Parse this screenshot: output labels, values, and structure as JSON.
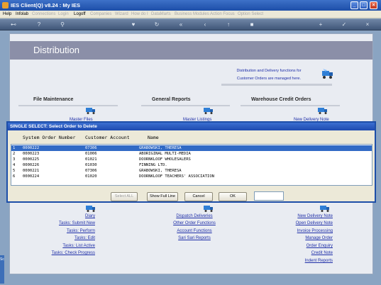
{
  "window": {
    "title": "IES Client(Q) v8.24 : My IES",
    "min": "_",
    "max": "□",
    "close": "×"
  },
  "menu": [
    {
      "label": "Help",
      "enabled": true
    },
    {
      "label": "Infolab",
      "enabled": true
    },
    {
      "label": "Connections",
      "enabled": false
    },
    {
      "label": "Login",
      "enabled": false
    },
    {
      "label": "Logoff",
      "enabled": true
    },
    {
      "label": "Companies",
      "enabled": false
    },
    {
      "label": "Wizard",
      "enabled": false
    },
    {
      "label": "How do I",
      "enabled": false
    },
    {
      "label": "DataMarts",
      "enabled": false
    },
    {
      "label": "Business Modules",
      "enabled": false
    },
    {
      "label": "Action Focus",
      "enabled": false
    },
    {
      "label": "Option Select",
      "enabled": false
    }
  ],
  "toolbar_icons": [
    "key-icon",
    "help-icon",
    "search-icon",
    "heart-icon",
    "refresh-icon",
    "rewind-icon",
    "back-icon",
    "forward-icon",
    "up-icon",
    "stop-icon",
    "add-icon",
    "check-icon",
    "close-icon"
  ],
  "page": {
    "title": "Distribution",
    "info_line1": "Distribution and Delivery functions for",
    "info_line2": "Customer Orders are managed here.",
    "sections": {
      "file_maintenance": "File Maintenance",
      "general_reports": "General Reports",
      "warehouse_credit": "Warehouse Credit Orders"
    },
    "peek_links": {
      "left": "Master Files",
      "middle": "Master Listings",
      "right": "New Delivery Note"
    },
    "left_links": [
      "Diary",
      "Tasks: Submit New",
      "Tasks: Perform",
      "Tasks: Edit",
      "Tasks: List Active",
      "Tasks: Check Progress"
    ],
    "middle_links": [
      "Dispatch Deliveries",
      "Other Order Functions",
      "Account Functions",
      "Sari Sari Reports"
    ],
    "right_links": [
      "New Delivery Note",
      "Open Delivery Note",
      "Invoice Processing",
      "Manage Order",
      "Order Enquiry",
      "Credit Note",
      "Indent Reports"
    ]
  },
  "dialog": {
    "title": "SINGLE SELECT: Select Order to Delete",
    "columns": {
      "num": "",
      "order": "System Order Number",
      "account": "Customer Account",
      "name": "Name"
    },
    "rows": [
      {
        "n": "1",
        "order": "0000222",
        "account": "07306",
        "name": "GRABOWSKI, THERESA",
        "selected": true
      },
      {
        "n": "2",
        "order": "0000223",
        "account": "01006",
        "name": "ABORIGINAL MULTI-MEDIA",
        "selected": false
      },
      {
        "n": "3",
        "order": "0000225",
        "account": "01021",
        "name": "DOORNKLOOF WHOLESALERS",
        "selected": false
      },
      {
        "n": "4",
        "order": "0000226",
        "account": "01030",
        "name": "FINNING LTD.",
        "selected": false
      },
      {
        "n": "5",
        "order": "0000221",
        "account": "07306",
        "name": "GRABOWSKI, THERESA",
        "selected": false
      },
      {
        "n": "6",
        "order": "0000224",
        "account": "01020",
        "name": "DOORNKLOOF TEACHERS' ASSOCIATION",
        "selected": false
      }
    ],
    "buttons": {
      "select_all": "Select ALL",
      "show_full": "Show Full Line",
      "cancel": "Cancel",
      "ok": "OK"
    },
    "search_value": ""
  },
  "side_tab": "Sc",
  "colors": {
    "accent": "#1d4ea8",
    "link": "#1f2fa8",
    "selected_row": "#316ac5"
  }
}
